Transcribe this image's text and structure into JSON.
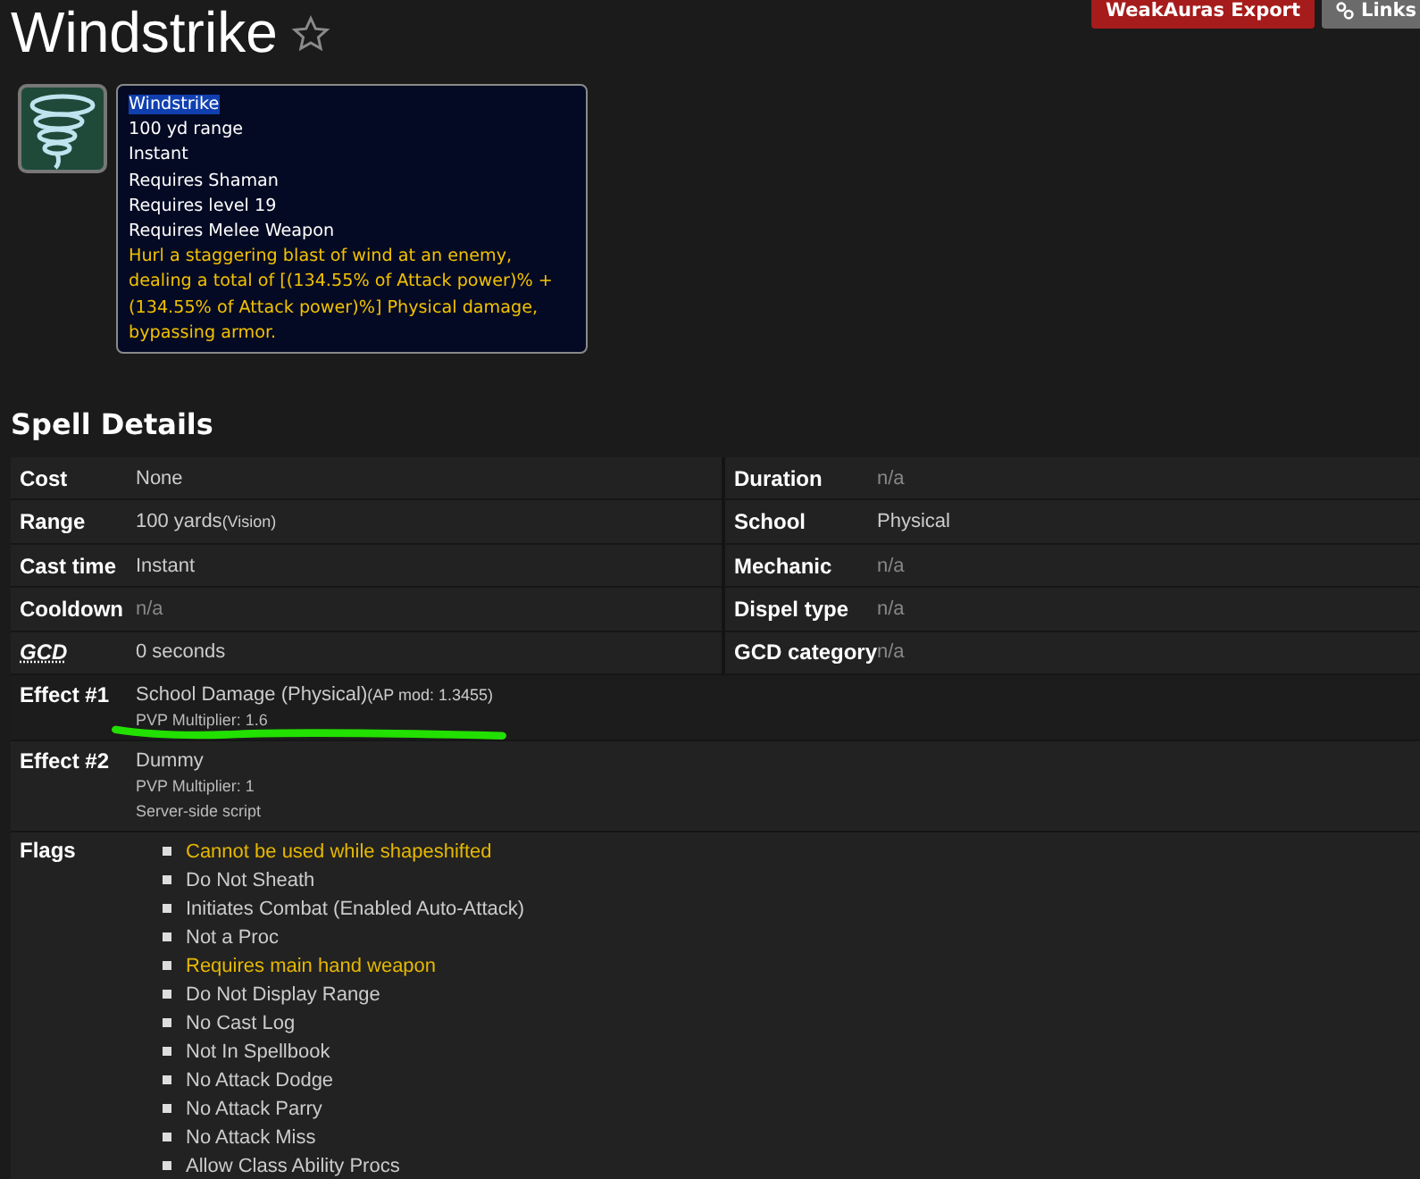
{
  "page": {
    "title": "Windstrike",
    "favorite": false
  },
  "actions": [
    {
      "kind": "export",
      "label": "WeakAuras Export"
    },
    {
      "kind": "links",
      "label": "Links"
    }
  ],
  "tooltip": {
    "name": "Windstrike",
    "lines": [
      "100 yd range",
      "Instant",
      "Requires Shaman",
      "Requires level 19",
      "Requires Melee Weapon"
    ],
    "description": "Hurl a staggering blast of wind at an enemy, dealing a total of [(134.55% of Attack power)% + (134.55% of Attack power)%] Physical damage, bypassing armor."
  },
  "section_title": "Spell Details",
  "details_left": [
    {
      "label": "Cost",
      "value": "None",
      "muted": false,
      "underlined": false
    },
    {
      "label": "Range",
      "value": "100 yards",
      "note": "(Vision)",
      "muted": false,
      "underlined": false
    },
    {
      "label": "Cast time",
      "value": "Instant",
      "muted": false,
      "underlined": false
    },
    {
      "label": "Cooldown",
      "value": "n/a",
      "muted": true,
      "underlined": false
    },
    {
      "label": "GCD",
      "value": "0 seconds",
      "muted": false,
      "underlined": true
    }
  ],
  "details_right": [
    {
      "label": "Duration",
      "value": "n/a",
      "muted": true
    },
    {
      "label": "School",
      "value": "Physical",
      "muted": false
    },
    {
      "label": "Mechanic",
      "value": "n/a",
      "muted": true
    },
    {
      "label": "Dispel type",
      "value": "n/a",
      "muted": true
    },
    {
      "label": "GCD category",
      "value": "n/a",
      "muted": true
    }
  ],
  "effects": [
    {
      "label": "Effect #1",
      "value": "School Damage (Physical)",
      "note": "(AP mod: 1.3455)",
      "sublines": [
        "PVP Multiplier: 1.6"
      ],
      "highlighted": true
    },
    {
      "label": "Effect #2",
      "value": "Dummy",
      "sublines": [
        "PVP Multiplier: 1",
        "Server-side script"
      ],
      "highlighted": false
    }
  ],
  "flags": {
    "label": "Flags",
    "items": [
      {
        "text": "Cannot be used while shapeshifted",
        "highlighted": true
      },
      {
        "text": "Do Not Sheath",
        "highlighted": false
      },
      {
        "text": "Initiates Combat (Enabled Auto-Attack)",
        "highlighted": false
      },
      {
        "text": "Not a Proc",
        "highlighted": false
      },
      {
        "text": "Requires main hand weapon",
        "highlighted": true
      },
      {
        "text": "Do Not Display Range",
        "highlighted": false
      },
      {
        "text": "No Cast Log",
        "highlighted": false
      },
      {
        "text": "Not In Spellbook",
        "highlighted": false
      },
      {
        "text": "No Attack Dodge",
        "highlighted": false
      },
      {
        "text": "No Attack Parry",
        "highlighted": false
      },
      {
        "text": "No Attack Miss",
        "highlighted": false
      },
      {
        "text": "Allow Class Ability Procs",
        "highlighted": false
      }
    ]
  }
}
